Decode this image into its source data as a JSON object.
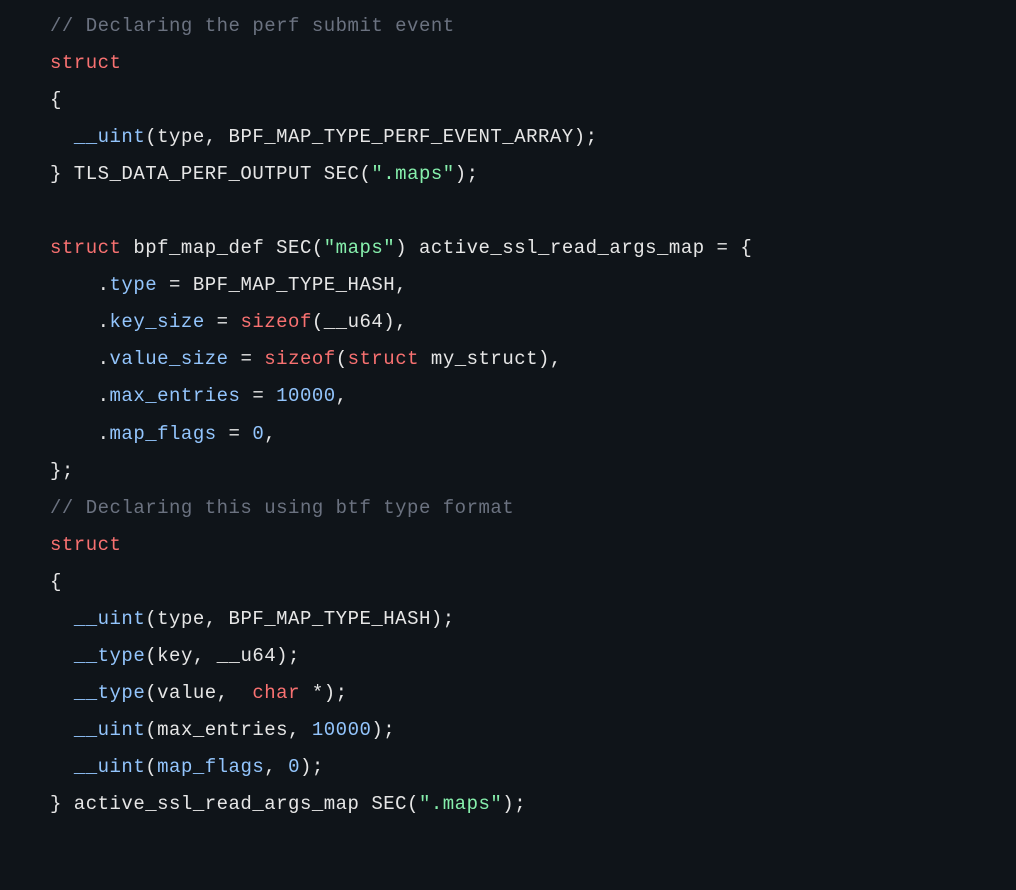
{
  "lines": [
    {
      "tokens": [
        {
          "text": "// Declaring the perf submit event",
          "class": "comment"
        }
      ]
    },
    {
      "tokens": [
        {
          "text": "struct",
          "class": "keyword"
        }
      ]
    },
    {
      "tokens": [
        {
          "text": "{",
          "class": "default"
        }
      ]
    },
    {
      "tokens": [
        {
          "text": "  ",
          "class": "default"
        },
        {
          "text": "__uint",
          "class": "function"
        },
        {
          "text": "(type, BPF_MAP_TYPE_PERF_EVENT_ARRAY);",
          "class": "default"
        }
      ]
    },
    {
      "tokens": [
        {
          "text": "} TLS_DATA_PERF_OUTPUT SEC(",
          "class": "default"
        },
        {
          "text": "\".maps\"",
          "class": "string"
        },
        {
          "text": ");",
          "class": "default"
        }
      ]
    },
    {
      "tokens": [
        {
          "text": " ",
          "class": "default"
        }
      ]
    },
    {
      "tokens": [
        {
          "text": "struct",
          "class": "keyword"
        },
        {
          "text": " bpf_map_def SEC(",
          "class": "default"
        },
        {
          "text": "\"maps\"",
          "class": "string"
        },
        {
          "text": ") active_ssl_read_args_map = {",
          "class": "default"
        }
      ]
    },
    {
      "tokens": [
        {
          "text": "    .",
          "class": "default"
        },
        {
          "text": "type",
          "class": "property"
        },
        {
          "text": " = BPF_MAP_TYPE_HASH,",
          "class": "default"
        }
      ]
    },
    {
      "tokens": [
        {
          "text": "    .",
          "class": "default"
        },
        {
          "text": "key_size",
          "class": "property"
        },
        {
          "text": " = ",
          "class": "default"
        },
        {
          "text": "sizeof",
          "class": "type"
        },
        {
          "text": "(__u64),",
          "class": "default"
        }
      ]
    },
    {
      "tokens": [
        {
          "text": "    .",
          "class": "default"
        },
        {
          "text": "value_size",
          "class": "property"
        },
        {
          "text": " = ",
          "class": "default"
        },
        {
          "text": "sizeof",
          "class": "type"
        },
        {
          "text": "(",
          "class": "default"
        },
        {
          "text": "struct",
          "class": "keyword"
        },
        {
          "text": " my_struct),",
          "class": "default"
        }
      ]
    },
    {
      "tokens": [
        {
          "text": "    .",
          "class": "default"
        },
        {
          "text": "max_entries",
          "class": "property"
        },
        {
          "text": " = ",
          "class": "default"
        },
        {
          "text": "10000",
          "class": "number"
        },
        {
          "text": ",",
          "class": "default"
        }
      ]
    },
    {
      "tokens": [
        {
          "text": "    .",
          "class": "default"
        },
        {
          "text": "map_flags",
          "class": "property"
        },
        {
          "text": " = ",
          "class": "default"
        },
        {
          "text": "0",
          "class": "number"
        },
        {
          "text": ",",
          "class": "default"
        }
      ]
    },
    {
      "tokens": [
        {
          "text": "};",
          "class": "default"
        }
      ]
    },
    {
      "tokens": [
        {
          "text": "// Declaring this using btf type format",
          "class": "comment"
        }
      ]
    },
    {
      "tokens": [
        {
          "text": "struct",
          "class": "keyword"
        }
      ]
    },
    {
      "tokens": [
        {
          "text": "{",
          "class": "default"
        }
      ]
    },
    {
      "tokens": [
        {
          "text": "  ",
          "class": "default"
        },
        {
          "text": "__uint",
          "class": "function"
        },
        {
          "text": "(type, BPF_MAP_TYPE_HASH);",
          "class": "default"
        }
      ]
    },
    {
      "tokens": [
        {
          "text": "  ",
          "class": "default"
        },
        {
          "text": "__type",
          "class": "function"
        },
        {
          "text": "(key, __u64);",
          "class": "default"
        }
      ]
    },
    {
      "tokens": [
        {
          "text": "  ",
          "class": "default"
        },
        {
          "text": "__type",
          "class": "function"
        },
        {
          "text": "(value,  ",
          "class": "default"
        },
        {
          "text": "char",
          "class": "type"
        },
        {
          "text": " *);",
          "class": "default"
        }
      ]
    },
    {
      "tokens": [
        {
          "text": "  ",
          "class": "default"
        },
        {
          "text": "__uint",
          "class": "function"
        },
        {
          "text": "(max_entries, ",
          "class": "default"
        },
        {
          "text": "10000",
          "class": "number"
        },
        {
          "text": ");",
          "class": "default"
        }
      ]
    },
    {
      "tokens": [
        {
          "text": "  ",
          "class": "default"
        },
        {
          "text": "__uint",
          "class": "function"
        },
        {
          "text": "(",
          "class": "default"
        },
        {
          "text": "map_flags",
          "class": "property"
        },
        {
          "text": ", ",
          "class": "default"
        },
        {
          "text": "0",
          "class": "number"
        },
        {
          "text": ");",
          "class": "default"
        }
      ]
    },
    {
      "tokens": [
        {
          "text": "} active_ssl_read_args_map SEC(",
          "class": "default"
        },
        {
          "text": "\".maps\"",
          "class": "string"
        },
        {
          "text": ");",
          "class": "default"
        }
      ]
    }
  ]
}
